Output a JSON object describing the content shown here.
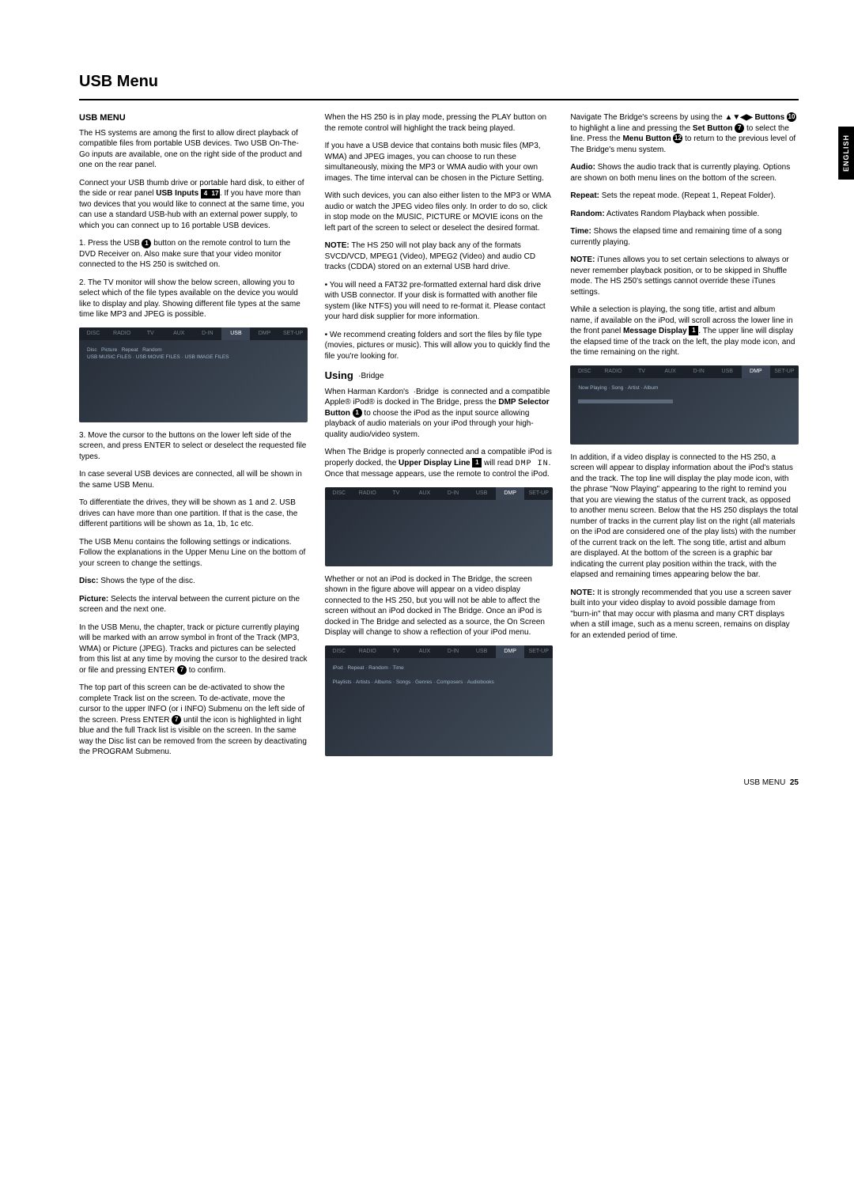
{
  "language_tab": "ENGLISH",
  "page_title": "USB Menu",
  "footer_label": "USB MENU",
  "footer_page": "25",
  "icons": {
    "c1": "1",
    "c7": "7",
    "c10": "10",
    "c12": "12",
    "s4": "4",
    "s17": "17",
    "s1": "1"
  },
  "h_usb_menu": "USB MENU",
  "p_intro": "The HS systems are among the first to allow direct playback of compatible files from portable USB devices. Two USB On-The-Go inputs are available, one on the right side of the product and one on the rear panel.",
  "p_connect_a": "Connect your USB thumb drive or portable hard disk, to either of the side or rear panel ",
  "p_connect_b": "USB Inputs",
  "p_connect_c": ". If you have more than two devices that you would like to connect at the same time, you can use a standard USB-hub with an external power supply, to which you can connect up to 16 portable USB devices.",
  "step1_a": "1. Press the USB ",
  "step1_b": " button on the remote control to turn the DVD Receiver on. Also make sure that your video monitor connected to the HS 250 is switched on.",
  "step2": "2. The TV monitor will show the below screen, allowing you to select which of the file types available on the device you would like to display and play. Showing different file types at the same time like MP3 and JPEG is possible.",
  "step3": "3. Move the cursor to the buttons on the lower left side of the screen, and press ENTER to select or deselect the requested file types.",
  "p_several": "In case several USB devices are connected, all will be shown in the same USB Menu.",
  "p_several2": "To differentiate the drives, they will be shown as 1 and 2. USB drives can have more than one partition. If that is the case, the different partitions will be shown as 1a, 1b, 1c etc.",
  "p_settings": "The USB Menu contains the following settings or indications. Follow the explanations in the Upper Menu Line on the bottom of your screen to change the settings.",
  "disc_label": "Disc:",
  "disc_text": " Shows the type of the disc.",
  "pic_label": "Picture:",
  "pic_text": " Selects the interval between the current picture on the screen and the next one.",
  "p_chapter": "In the USB Menu, the chapter, track or picture currently playing will be marked with an arrow symbol in front of the Track (MP3, WMA) or Picture (JPEG). Tracks and pictures can be selected from this list at any time by moving the cursor to the desired track or file and pressing ENTER ",
  "p_chapter_end": " to confirm.",
  "p_top_a": "The top part of this screen can be de-activated to show the complete Track list on the screen. To de-activate, move the cursor to the upper INFO (or i INFO) Submenu on the left side of the screen. Press ENTER ",
  "p_top_b": " until the icon is highlighted in light blue and the full Track list is visible on the screen. In the same way the Disc list can be removed from the screen by deactivating the PROGRAM Submenu.",
  "p_playmode": "When the HS 250 is in play mode, pressing the PLAY button on the remote control will highlight the track being played.",
  "p_mix": "If you have a USB device that contains both music files (MP3, WMA) and JPEG images, you can choose to run these simultaneously, mixing the MP3 or WMA audio with your own images. The time interval can be chosen in the Picture Setting.",
  "p_such": "With such devices, you can also either listen to the MP3 or WMA audio or watch the JPEG video files only. In order to do so, click in stop mode on the MUSIC, PICTURE or MOVIE icons on the left part of the screen to select or deselect the desired format.",
  "note1_label": "NOTE:",
  "note1_text": " The HS 250 will not play back any of the formats SVCD/VCD, MPEG1 (Video), MPEG2 (Video) and audio CD tracks (CDDA) stored on an external USB hard drive.",
  "b_fat32": "• You will need a FAT32 pre-formatted external hard disk drive with USB connector. If your disk is formatted with another file system (like NTFS) you will need to re-format it. Please contact your hard disk supplier for more information.",
  "b_folders": "• We recommend creating folders and sort the files by file type (movies, pictures or music). This will allow you to quickly find the file you're looking for.",
  "h_using": "Using ",
  "bridge_brand": " ·Bridge ",
  "p_bridge_a": "When Harman Kardon's ",
  "p_bridge_b": " is connected and a compatible Apple® iPod® is docked in The Bridge, press the ",
  "p_bridge_c": "DMP Selector Button ",
  "p_bridge_d": " to choose the iPod as the input source allowing playback of audio materials on your iPod through your high-quality audio/video system.",
  "p_upper_a": "When The Bridge is properly connected and a compatible iPod is properly docked, the ",
  "p_upper_b": "Upper Display Line ",
  "p_upper_c": " will read ",
  "p_upper_d": ". Once that message appears, use the remote to control the iPod.",
  "dmpin": "DMP IN",
  "p_whether": "Whether or not an iPod is docked in The Bridge, the screen shown in the figure above will appear on a video display connected to the HS 250, but you will not be able to affect the screen without an iPod docked in The Bridge. Once an iPod is docked in The Bridge and selected as a source, the On Screen Display will change to show a reflection of your iPod menu.",
  "p_nav_a": "Navigate The Bridge's screens by using the ",
  "p_nav_arrows": "▲▼◀▶ Buttons ",
  "p_nav_b": " to highlight a line and pressing the ",
  "set_btn": "Set Button ",
  "p_nav_c": " to select the line. Press the ",
  "menu_btn": "Menu Button ",
  "p_nav_d": " to return to the previous level of The Bridge's menu system.",
  "audio_label": "Audio:",
  "audio_text": " Shows the audio track that is currently playing. Options are shown on both menu lines on the bottom of the screen.",
  "repeat_label": "Repeat:",
  "repeat_text": " Sets the repeat mode. (Repeat 1, Repeat Folder).",
  "random_label": "Random:",
  "random_text": " Activates Random Playback when possible.",
  "time_label": "Time:",
  "time_text": " Shows the elapsed time and remaining time of a song currently playing.",
  "note2_label": "NOTE:",
  "note2_text": " iTunes allows you to set certain selections to always or never remember playback position, or to be skipped in Shuffle mode. The HS 250's settings cannot override these iTunes settings.",
  "p_msg_a": "While a selection is playing, the song title, artist and album name, if available on the iPod, will scroll across the lower line in the front panel ",
  "p_msg_b": "Message Display ",
  "p_msg_c": ". The upper line will display the elapsed time of the track on the left, the play mode icon, and the time remaining on the right.",
  "p_inaddition": "In addition, if a video display is connected to the HS 250, a screen will appear to display information about the iPod's status and the track. The top line will display the play mode icon, with the phrase \"Now Playing\" appearing to the right to remind you that you are viewing the status of the current track, as opposed to another menu screen. Below that the HS 250 displays the total number of tracks in the current play list on the right (all materials on the iPod are considered one of the play lists) with the number of the current track on the left. The song title, artist and album are displayed. At the bottom of the screen is a graphic bar indicating the current play position within the track, with the elapsed and remaining times appearing below the bar.",
  "note3_label": "NOTE:",
  "note3_text": " It is strongly recommended that you use a screen saver built into your video display to avoid possible damage from \"burn-in\" that may occur with plasma and many CRT displays when a still image, such as a menu screen, remains on display for an extended period of time.",
  "tabs": [
    "DISC",
    "RADIO",
    "TV",
    "AUX",
    "D-IN",
    "USB",
    "DMP",
    "SET-UP"
  ]
}
